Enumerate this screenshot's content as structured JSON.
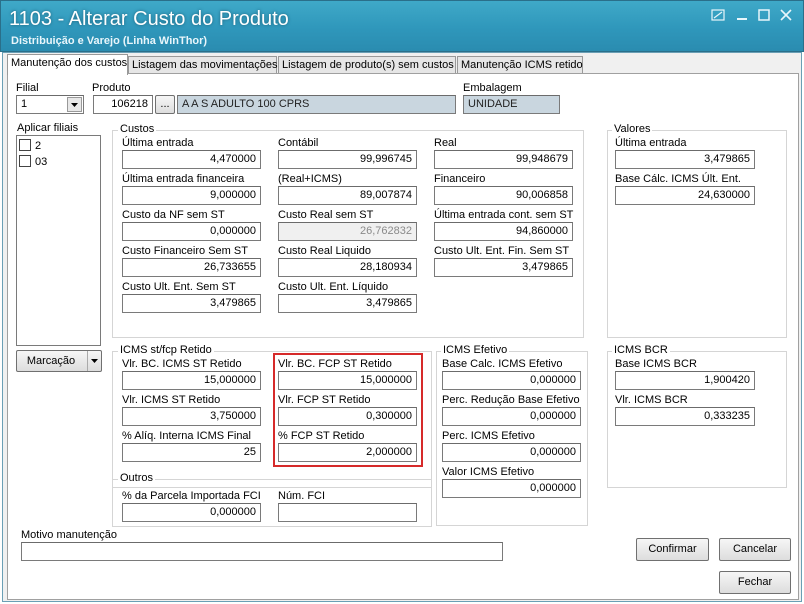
{
  "window": {
    "title": "1103 - Alterar Custo do Produto",
    "subtitle": "Distribuição e Varejo (Linha WinThor)"
  },
  "tabs": [
    {
      "label": "Manutenção dos custos"
    },
    {
      "label": "Listagem das movimentações"
    },
    {
      "label": "Listagem de produto(s)  sem custos"
    },
    {
      "label": "Manutenção ICMS retido"
    }
  ],
  "header": {
    "filial_label": "Filial",
    "filial_value": "1",
    "produto_label": "Produto",
    "produto_code": "106218",
    "browse_label": "...",
    "produto_desc": "A A S ADULTO 100 CPRS",
    "embalagem_label": "Embalagem",
    "embalagem_value": "UNIDADE"
  },
  "aplicar_filiais": {
    "label": "Aplicar filiais",
    "items": [
      {
        "label": "2"
      },
      {
        "label": "03"
      }
    ],
    "marcacao_label": "Marcação"
  },
  "custos": {
    "title": "Custos",
    "ultima_entrada": {
      "label": "Última entrada",
      "value": "4,470000"
    },
    "contabil": {
      "label": "Contábil",
      "value": "99,996745"
    },
    "real": {
      "label": "Real",
      "value": "99,948679"
    },
    "ultima_entrada_fin": {
      "label": "Última entrada financeira",
      "value": "9,000000"
    },
    "real_icms": {
      "label": "(Real+ICMS)",
      "value": "89,007874"
    },
    "financeiro": {
      "label": "Financeiro",
      "value": "90,006858"
    },
    "custo_nf_sem_st": {
      "label": "Custo da NF sem ST",
      "value": "0,000000"
    },
    "custo_real_sem_st": {
      "label": "Custo Real sem ST",
      "value": "26,762832"
    },
    "ultima_entrada_cont_sem_st": {
      "label": "Última entrada cont. sem ST",
      "value": "94,860000"
    },
    "custo_fin_sem_st": {
      "label": "Custo Financeiro Sem ST",
      "value": "26,733655"
    },
    "custo_real_liquido": {
      "label": "Custo Real Liquido",
      "value": "28,180934"
    },
    "custo_ult_ent_fin_sem_st": {
      "label": "Custo Ult. Ent. Fin. Sem ST",
      "value": "3,479865"
    },
    "custo_ult_ent_sem_st": {
      "label": "Custo Ult. Ent. Sem ST",
      "value": "3,479865"
    },
    "custo_ult_ent_liquido": {
      "label": "Custo Ult. Ent. Líquido",
      "value": "3,479865"
    }
  },
  "valores": {
    "title": "Valores",
    "ultima_entrada": {
      "label": "Última entrada",
      "value": "3,479865"
    },
    "base_calc_icms": {
      "label": "Base Cálc. ICMS Últ. Ent.",
      "value": "24,630000"
    }
  },
  "icms_st": {
    "title": "ICMS st/fcp Retido",
    "vlr_bc_icms_st": {
      "label": "Vlr. BC. ICMS ST Retido",
      "value": "15,000000"
    },
    "vlr_icms_st": {
      "label": "Vlr. ICMS ST Retido",
      "value": "3,750000"
    },
    "aliq_interna": {
      "label": "% Alíq. Interna ICMS Final",
      "value": "25"
    },
    "vlr_bc_fcp_st": {
      "label": "Vlr. BC. FCP ST Retido",
      "value": "15,000000"
    },
    "vlr_fcp_st": {
      "label": "Vlr. FCP ST Retido",
      "value": "0,300000"
    },
    "perc_fcp_st": {
      "label": "% FCP ST Retido",
      "value": "2,000000"
    }
  },
  "icms_efetivo": {
    "title": "ICMS Efetivo",
    "base_calc": {
      "label": "Base Calc. ICMS Efetivo",
      "value": "0,000000"
    },
    "perc_reducao": {
      "label": "Perc. Redução Base Efetivo",
      "value": "0,000000"
    },
    "perc_icms": {
      "label": "Perc. ICMS Efetivo",
      "value": "0,000000"
    },
    "valor_icms": {
      "label": "Valor ICMS Efetivo",
      "value": "0,000000"
    }
  },
  "icms_bcr": {
    "title": "ICMS BCR",
    "base": {
      "label": "Base ICMS BCR",
      "value": "1,900420"
    },
    "vlr": {
      "label": "Vlr. ICMS BCR",
      "value": "0,333235"
    }
  },
  "outros": {
    "title": "Outros",
    "parcela_importada": {
      "label": "% da Parcela Importada FCI",
      "value": "0,000000"
    },
    "num_fci": {
      "label": "Núm. FCI",
      "value": ""
    }
  },
  "footer": {
    "motivo_label": "Motivo manutenção",
    "motivo_value": "",
    "confirmar_label": "Confirmar",
    "cancelar_label": "Cancelar",
    "fechar_label": "Fechar"
  },
  "colors": {
    "title_bar": "#2f97bb",
    "highlight": "#d62a2a"
  }
}
